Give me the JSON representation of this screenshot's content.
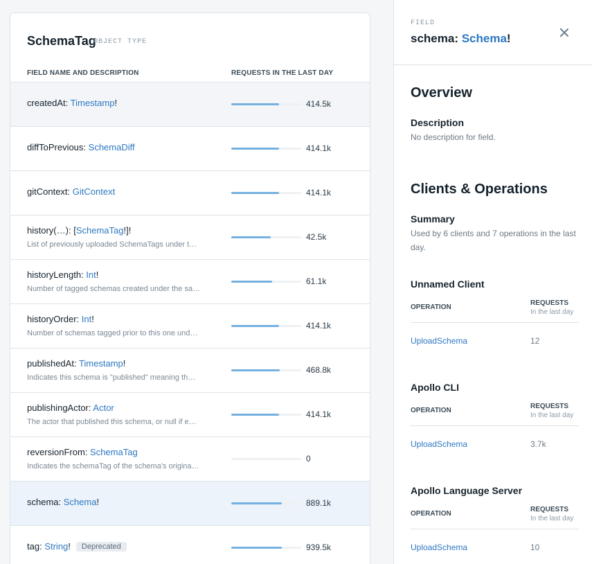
{
  "table": {
    "title": "SchemaTag",
    "type_label": "OBJECT TYPE",
    "col_field": "FIELD NAME AND DESCRIPTION",
    "col_requests": "REQUESTS IN THE LAST DAY",
    "rows": [
      {
        "name": "createdAt",
        "sep": ": ",
        "pre": "",
        "type": "Timestamp",
        "post": "!",
        "desc": "",
        "usage_fraction": 0.68,
        "value": "414.5k"
      },
      {
        "name": "diffToPrevious",
        "sep": ": ",
        "pre": "",
        "type": "SchemaDiff",
        "post": "",
        "desc": "",
        "usage_fraction": 0.68,
        "value": "414.1k"
      },
      {
        "name": "gitContext",
        "sep": ": ",
        "pre": "",
        "type": "GitContext",
        "post": "",
        "desc": "",
        "usage_fraction": 0.68,
        "value": "414.1k"
      },
      {
        "name": "history(…)",
        "sep": ": ",
        "pre": "[",
        "type": "SchemaTag",
        "post": "!]!",
        "desc": "List of previously uploaded SchemaTags under t…",
        "usage_fraction": 0.56,
        "value": "42.5k"
      },
      {
        "name": "historyLength",
        "sep": ": ",
        "pre": "",
        "type": "Int",
        "post": "!",
        "desc": "Number of tagged schemas created under the sa…",
        "usage_fraction": 0.58,
        "value": "61.1k"
      },
      {
        "name": "historyOrder",
        "sep": ": ",
        "pre": "",
        "type": "Int",
        "post": "!",
        "desc": "Number of schemas tagged prior to this one und…",
        "usage_fraction": 0.68,
        "value": "414.1k"
      },
      {
        "name": "publishedAt",
        "sep": ": ",
        "pre": "",
        "type": "Timestamp",
        "post": "!",
        "desc": "Indicates this schema is \"published\" meaning th…",
        "usage_fraction": 0.69,
        "value": "468.8k"
      },
      {
        "name": "publishingActor",
        "sep": ": ",
        "pre": "",
        "type": "Actor",
        "post": "",
        "desc": "The actor that published this schema, or null if e…",
        "usage_fraction": 0.68,
        "value": "414.1k"
      },
      {
        "name": "reversionFrom",
        "sep": ": ",
        "pre": "",
        "type": "SchemaTag",
        "post": "",
        "desc": "Indicates the schemaTag of the schema's origina…",
        "usage_fraction": 0.0,
        "value": "0"
      },
      {
        "name": "schema",
        "sep": ": ",
        "pre": "",
        "type": "Schema",
        "post": "!",
        "desc": "",
        "usage_fraction": 0.72,
        "value": "889.1k"
      },
      {
        "name": "tag",
        "sep": ": ",
        "pre": "",
        "type": "String",
        "post": "!",
        "desc": "",
        "badge": "Deprecated",
        "usage_fraction": 0.72,
        "value": "939.5k"
      }
    ]
  },
  "panel": {
    "kicker": "FIELD",
    "title_name": "schema",
    "title_sep": ": ",
    "title_type": "Schema",
    "title_post": "!",
    "overview_heading": "Overview",
    "description_label": "Description",
    "description_text": "No description for field.",
    "clients_heading": "Clients & Operations",
    "summary_label": "Summary",
    "summary_text": "Used by 6 clients and 7 operations in the last day.",
    "op_header": "OPERATION",
    "req_header": "REQUESTS",
    "req_sub": "In the last day",
    "clients": [
      {
        "name": "Unnamed Client",
        "operation": "UploadSchema",
        "requests": "12"
      },
      {
        "name": "Apollo CLI",
        "operation": "UploadSchema",
        "requests": "3.7k"
      },
      {
        "name": "Apollo Language Server",
        "operation": "UploadSchema",
        "requests": "10"
      }
    ]
  },
  "colors": {
    "link": "#2e78c2",
    "bar": "#74b0e0",
    "selected_row": "#ecf3fb"
  }
}
